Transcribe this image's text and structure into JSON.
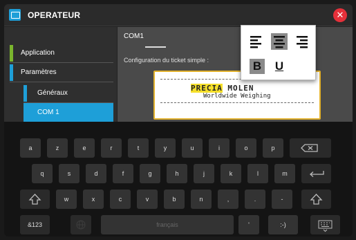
{
  "titlebar": {
    "title": "OPERATEUR",
    "close_symbol": "✕"
  },
  "sidebar": {
    "items": [
      {
        "label": "Application"
      },
      {
        "label": "Paramètres"
      },
      {
        "label": "Généraux"
      },
      {
        "label": "COM 1"
      }
    ]
  },
  "main": {
    "header": "COM1",
    "subtitle": "Configuration du ticket simple :",
    "ticket": {
      "line1": "PRECIA MOLEN",
      "line1_highlight": "PRECIA",
      "line1_rest": " MOLEN",
      "line2": "Worldwide Weighing"
    }
  },
  "format_popup": {
    "bold_label": "B",
    "underline_label": "U"
  },
  "keyboard": {
    "row1": [
      "a",
      "z",
      "e",
      "r",
      "t",
      "y",
      "u",
      "i",
      "o",
      "p"
    ],
    "row2": [
      "q",
      "s",
      "d",
      "f",
      "g",
      "h",
      "j",
      "k",
      "l",
      "m"
    ],
    "row3": [
      "w",
      "x",
      "c",
      "v",
      "b",
      "n",
      ",",
      ".",
      "-"
    ],
    "symbols_label": "&123",
    "space_label": "français",
    "apostrophe": "'",
    "smiley": ":-)"
  },
  "colors": {
    "accent": "#1e9fd8",
    "green": "#7ab52d",
    "close": "#e5303a",
    "ticket_border": "#e2b12c",
    "highlight": "#f5df2a"
  }
}
